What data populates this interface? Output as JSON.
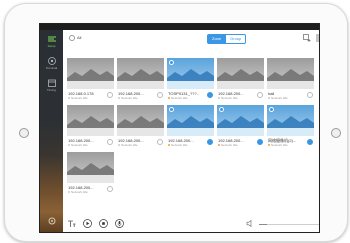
{
  "sidebar": {
    "items": [
      {
        "label": "Setup",
        "icon": "setup-icon",
        "active": true
      },
      {
        "label": "Terminal",
        "icon": "terminal-icon",
        "active": false
      },
      {
        "label": "Timing",
        "icon": "timing-icon",
        "active": false
      }
    ],
    "footer_icon": "settings-icon"
  },
  "toolbar": {
    "select_all_label": "All",
    "tabs": [
      {
        "label": "Zone",
        "active": true
      },
      {
        "label": "Group",
        "active": false
      }
    ],
    "right_icons": [
      "add-device-icon",
      "list-view-icon"
    ]
  },
  "cameras": [
    {
      "name": "192.168.0.178",
      "status": "Network   Idle",
      "thumb": "gray",
      "selected": false
    },
    {
      "name": "192.168.200...",
      "status": "Network   Idle",
      "thumb": "gray",
      "selected": false
    },
    {
      "name": "TOSP0131_???..",
      "status": "Network   Idle",
      "thumb": "blue",
      "selected": true
    },
    {
      "name": "192.168.200...",
      "status": "Network   Idle",
      "thumb": "gray",
      "selected": false
    },
    {
      "name": "hall",
      "status": "Network   Idle",
      "thumb": "gray",
      "selected": false
    },
    {
      "name": "192.168.200...",
      "status": "Network   Idle",
      "thumb": "gray",
      "selected": false
    },
    {
      "name": "192.168.200...",
      "status": "Network   Idle",
      "thumb": "gray",
      "selected": false
    },
    {
      "name": "192.168.200...",
      "status": "Network   Idle",
      "thumb": "blue",
      "selected": true
    },
    {
      "name": "192.168.200...",
      "status": "Network   Idle",
      "thumb": "blue",
      "selected": true
    },
    {
      "name": "网络摄像机(2)...",
      "status": "Network   Idle",
      "thumb": "blue",
      "selected": true
    },
    {
      "name": "192.168.200...",
      "status": "Network   Idle",
      "thumb": "gray",
      "selected": false
    }
  ],
  "bottombar": {
    "icons": [
      "text-icon",
      "play-icon",
      "stop-icon",
      "microphone-icon",
      "volume-icon",
      "bell-icon"
    ],
    "volume_level": 0.12
  },
  "colors": {
    "accent": "#3a97e5",
    "active_green": "#7ed957",
    "sidebar_top": "#2a2f36",
    "sidebar_bottom": "#8a6135"
  }
}
